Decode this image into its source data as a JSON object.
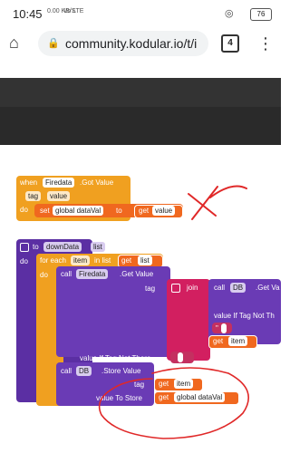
{
  "status": {
    "time": "10:45",
    "speed": "0.00 KB/S",
    "net": "Vo LTE",
    "battery": "76"
  },
  "browser": {
    "url": "community.kodular.io/t/i",
    "tab_count": "4"
  },
  "block1": {
    "when": "when",
    "component": "Firedata",
    "event": ".Got Value",
    "tag": "tag",
    "value": "value",
    "do": "do",
    "set": "set",
    "var": "global dataVal",
    "to": "to",
    "get": "get",
    "getvar": "value"
  },
  "block2": {
    "to": "to",
    "proc": "downData",
    "param": "list",
    "do": "do",
    "foreach": "for each",
    "item": "item",
    "inlist": "in list",
    "get": "get",
    "getlist": "list",
    "do2": "do",
    "call": "call",
    "firedata": "Firedata",
    "getvalue": ".Get Value",
    "tag": "tag",
    "join": "join",
    "db": "DB",
    "dbget": ".Get Va",
    "vitnt": "value If Tag Not Th",
    "quote": "\"",
    "getitem": "item",
    "vitnt2": "value If Tag Not There",
    "store": ".Store Value",
    "tag2": "tag",
    "vts": "value To Store",
    "getitem2": "item",
    "getglobal": "global dataVal"
  }
}
